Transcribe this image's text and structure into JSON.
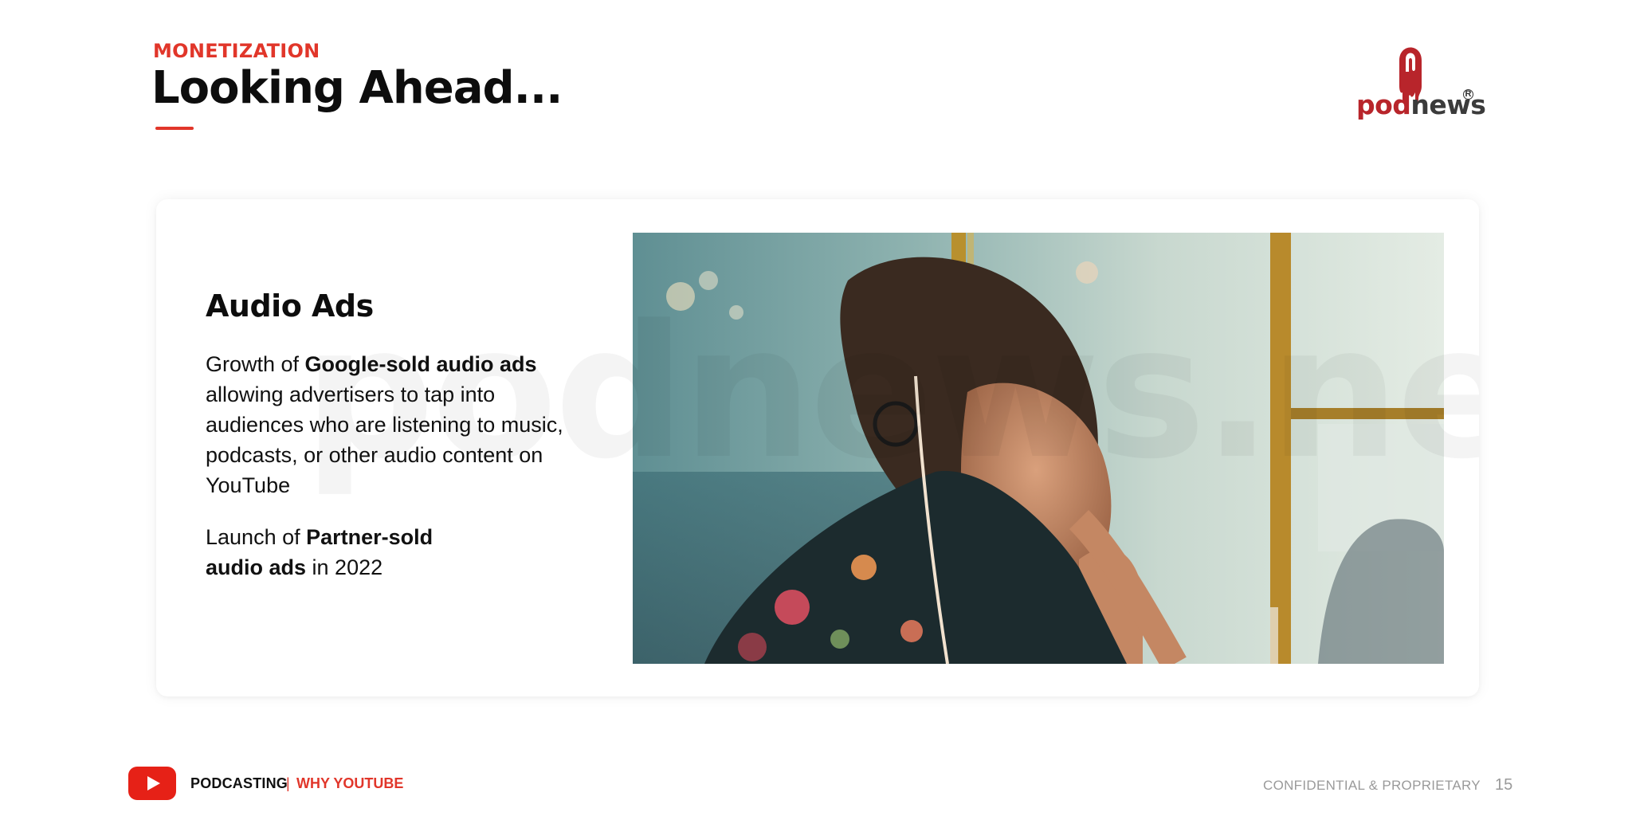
{
  "header": {
    "section_label": "MONETIZATION",
    "title": "Looking Ahead..."
  },
  "logo": {
    "word_part1": "pod",
    "word_part2": "news",
    "registered": "R",
    "colors": {
      "pod": "#b8252b",
      "news": "#3b3b3b"
    }
  },
  "card": {
    "watermark": "podnews.net",
    "heading": "Audio Ads",
    "paragraph1": {
      "prefix": "Growth of ",
      "bold": "Google-sold audio ads",
      "suffix": " allowing advertisers to tap into audiences who are listening to music, podcasts, or other audio content on YouTube"
    },
    "paragraph2": {
      "prefix": "Launch of ",
      "bold": "Partner-sold audio ads",
      "suffix": " in 2022"
    },
    "photo_icon": "woman-with-earphones-photo"
  },
  "footer": {
    "brand": "PODCASTING",
    "separator": "|",
    "section": "WHY YOUTUBE",
    "confidential": "CONFIDENTIAL & PROPRIETARY",
    "page_number": "15",
    "icon": "youtube-play-icon"
  },
  "colors": {
    "accent": "#e1362a",
    "youtube": "#e62117",
    "muted": "#9a9a9a"
  }
}
